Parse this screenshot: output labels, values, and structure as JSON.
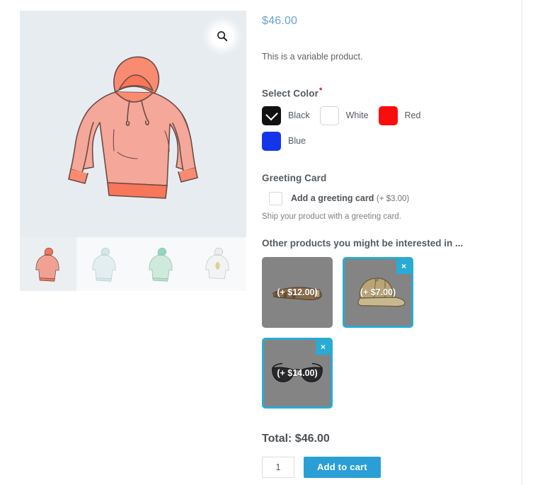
{
  "gallery": {
    "zoom_icon": "search-icon",
    "main_alt": "Salmon pull-over hoodie illustration",
    "thumbs": [
      {
        "alt": "Salmon hoodie thumbnail",
        "active": true,
        "body": "#f0a193",
        "accent": "#f4775c",
        "line": "#6b4b45"
      },
      {
        "alt": "Light blue hoodie thumbnail",
        "active": false,
        "body": "#e3eef0",
        "accent": "#d3e6e8",
        "line": "#b9cdd1"
      },
      {
        "alt": "Mint green hoodie thumbnail",
        "active": false,
        "body": "#cfe9dd",
        "accent": "#8fd9bd",
        "line": "#95bdac"
      },
      {
        "alt": "White hoodie thumbnail",
        "active": false,
        "body": "#f2f3f3",
        "accent": "#e3cf9c",
        "line": "#c3c9cb"
      }
    ]
  },
  "product": {
    "price": "$46.00",
    "short_description": "This is a variable product."
  },
  "color_field": {
    "label": "Select Color",
    "required_mark": "*",
    "options": [
      {
        "label": "Black",
        "hex": "#111111",
        "selected": true,
        "bordered": false
      },
      {
        "label": "White",
        "hex": "#ffffff",
        "selected": false,
        "bordered": true
      },
      {
        "label": "Red",
        "hex": "#fa0d0d",
        "selected": false,
        "bordered": false
      },
      {
        "label": "Blue",
        "hex": "#1436ea",
        "selected": false,
        "bordered": false
      }
    ]
  },
  "greeting_card": {
    "label": "Greeting Card",
    "checkbox_label": "Add a greeting card",
    "checkbox_price": "(+ $3.00)",
    "checked": false,
    "help_text": "Ship your product with a greeting card."
  },
  "other_products": {
    "title": "Other products you might be interested in ...",
    "items": [
      {
        "name": "belt",
        "price": "(+ $12.00)",
        "selected": false,
        "remove_label": "×"
      },
      {
        "name": "cap",
        "price": "(+ $7.00)",
        "selected": true,
        "remove_label": "×"
      },
      {
        "name": "sunglasses",
        "price": "(+ $14.00)",
        "selected": true,
        "remove_label": "×"
      }
    ]
  },
  "totals": {
    "total_label": "Total: $46.00"
  },
  "cart": {
    "quantity": "1",
    "quantity_placeholder": "1",
    "add_to_cart_label": "Add to cart"
  },
  "colors": {
    "accent_blue": "#2a9fd6",
    "price_blue": "#69a4d4",
    "selected_border": "#29abd4",
    "card_bg": "#848484",
    "image_bg": "#e7ecf1"
  }
}
